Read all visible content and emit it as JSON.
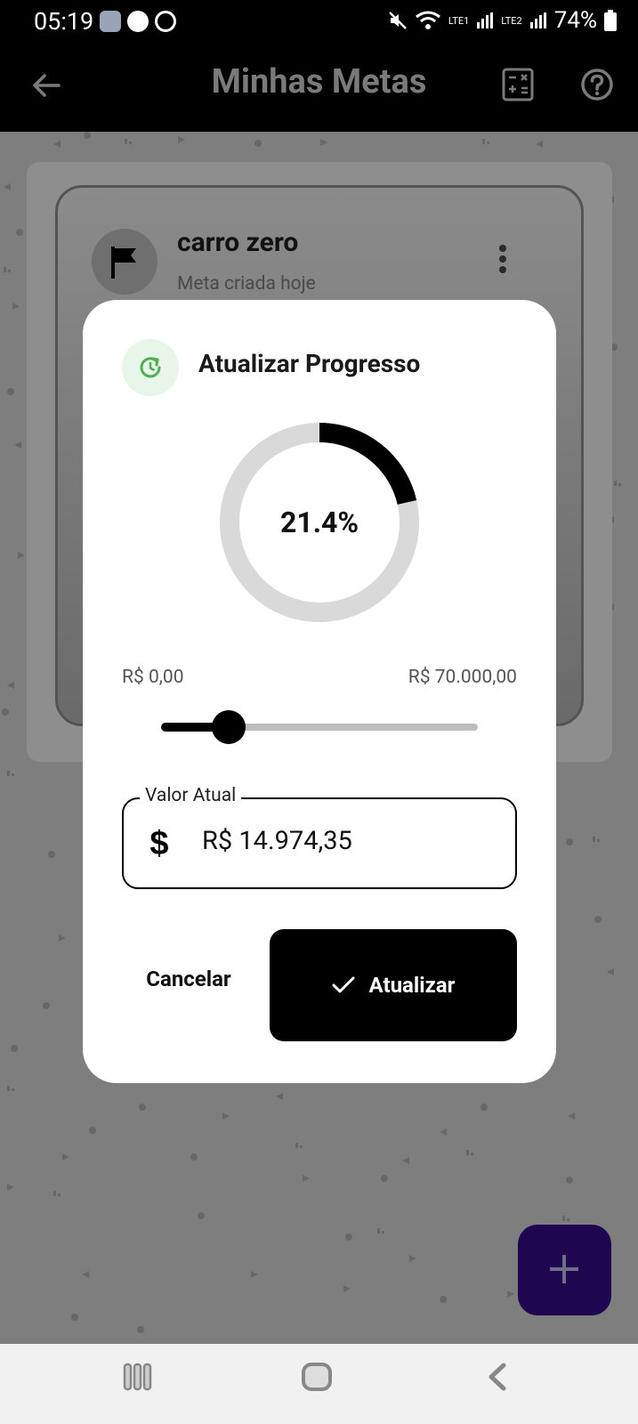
{
  "status_bar": {
    "time": "05:19",
    "battery": "74%",
    "lte1": "LTE1",
    "lte2": "LTE2"
  },
  "app_bar": {
    "title": "Minhas Metas",
    "icons": [
      "back-arrow-icon",
      "calculator-icon",
      "help-icon"
    ]
  },
  "goal_card": {
    "title": "carro zero",
    "subtitle": "Meta criada hoje"
  },
  "dialog": {
    "title": "Atualizar Progresso",
    "progress_label": "21.4%",
    "progress_fraction": 0.214,
    "range_min": "R$ 0,00",
    "range_max": "R$ 70.000,00",
    "slider_fraction": 0.214,
    "field_label": "Valor Atual",
    "field_value": "R$ 14.974,35",
    "cancel_label": "Cancelar",
    "update_label": "Atualizar"
  },
  "colors": {
    "accent": "#000000",
    "refresh_icon": "#4caf50",
    "fab": "#1e0750"
  }
}
